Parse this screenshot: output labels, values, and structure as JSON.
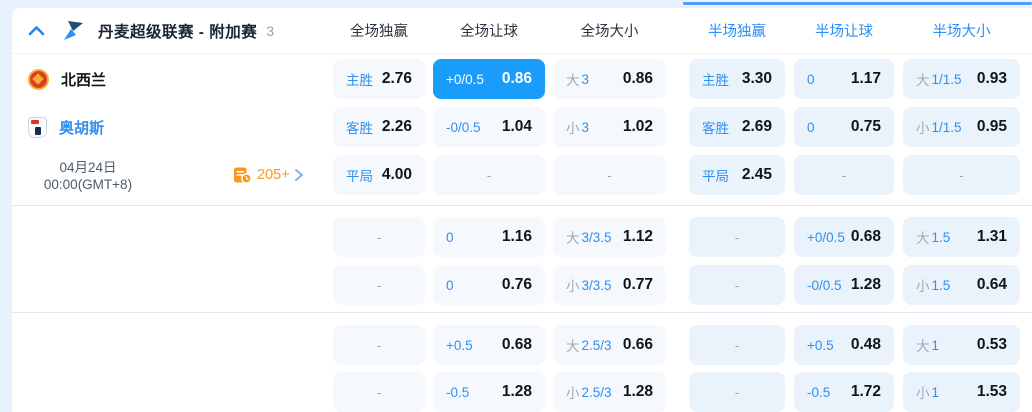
{
  "header": {
    "league": "丹麦超级联赛 - 附加赛",
    "count": "3",
    "columns": [
      "全场独赢",
      "全场让球",
      "全场大小",
      "半场独赢",
      "半场让球",
      "半场大小"
    ]
  },
  "match": {
    "home_team": "北西兰",
    "away_team": "奥胡斯",
    "date_line1": "04月24日",
    "date_line2": "00:00(GMT+8)",
    "more_count": "205+"
  },
  "icons": {
    "collapse": "chevron-up-icon",
    "league": "sport-logo-icon",
    "home_badge": "home-team-badge",
    "away_badge": "away-team-badge",
    "more": "markets-calendar-clock-icon",
    "more_chevron": "chevron-right-icon"
  },
  "colors": {
    "selected_cell": "#1a9cfb",
    "odds_label_blue": "#2f8ff2",
    "half_header_blue": "#2e8ef5",
    "orange": "#f7981d",
    "page_background": "#e8f1fd"
  },
  "rows": [
    {
      "cells": [
        {
          "label": "主胜",
          "value": "2.76"
        },
        {
          "label": "+0/0.5",
          "value": "0.86",
          "selected": true
        },
        {
          "prefix": "大",
          "label": "3",
          "value": "0.86"
        },
        {
          "label": "主胜",
          "value": "3.30"
        },
        {
          "label": "0",
          "value": "1.17"
        },
        {
          "prefix": "大",
          "label": "1/1.5",
          "value": "0.93"
        }
      ]
    },
    {
      "cells": [
        {
          "label": "客胜",
          "value": "2.26"
        },
        {
          "label": "-0/0.5",
          "value": "1.04"
        },
        {
          "prefix": "小",
          "label": "3",
          "value": "1.02"
        },
        {
          "label": "客胜",
          "value": "2.69"
        },
        {
          "label": "0",
          "value": "0.75"
        },
        {
          "prefix": "小",
          "label": "1/1.5",
          "value": "0.95"
        }
      ]
    },
    {
      "cells": [
        {
          "label": "平局",
          "value": "4.00"
        },
        {
          "dash": "-"
        },
        {
          "dash": "-"
        },
        {
          "label": "平局",
          "value": "2.45"
        },
        {
          "dash": "-"
        },
        {
          "dash": "-"
        }
      ]
    },
    {
      "cells": [
        {
          "dash": "-"
        },
        {
          "label": "0",
          "value": "1.16"
        },
        {
          "prefix": "大",
          "label": "3/3.5",
          "value": "1.12"
        },
        {
          "dash": "-"
        },
        {
          "label": "+0/0.5",
          "value": "0.68"
        },
        {
          "prefix": "大",
          "label": "1.5",
          "value": "1.31"
        }
      ]
    },
    {
      "cells": [
        {
          "dash": "-"
        },
        {
          "label": "0",
          "value": "0.76"
        },
        {
          "prefix": "小",
          "label": "3/3.5",
          "value": "0.77"
        },
        {
          "dash": "-"
        },
        {
          "label": "-0/0.5",
          "value": "1.28"
        },
        {
          "prefix": "小",
          "label": "1.5",
          "value": "0.64"
        }
      ]
    },
    {
      "cells": [
        {
          "dash": "-"
        },
        {
          "label": "+0.5",
          "value": "0.68"
        },
        {
          "prefix": "大",
          "label": "2.5/3",
          "value": "0.66"
        },
        {
          "dash": "-"
        },
        {
          "label": "+0.5",
          "value": "0.48"
        },
        {
          "prefix": "大",
          "label": "1",
          "value": "0.53"
        }
      ]
    },
    {
      "cells": [
        {
          "dash": "-"
        },
        {
          "label": "-0.5",
          "value": "1.28"
        },
        {
          "prefix": "小",
          "label": "2.5/3",
          "value": "1.28"
        },
        {
          "dash": "-"
        },
        {
          "label": "-0.5",
          "value": "1.72"
        },
        {
          "prefix": "小",
          "label": "1",
          "value": "1.53"
        }
      ]
    }
  ]
}
